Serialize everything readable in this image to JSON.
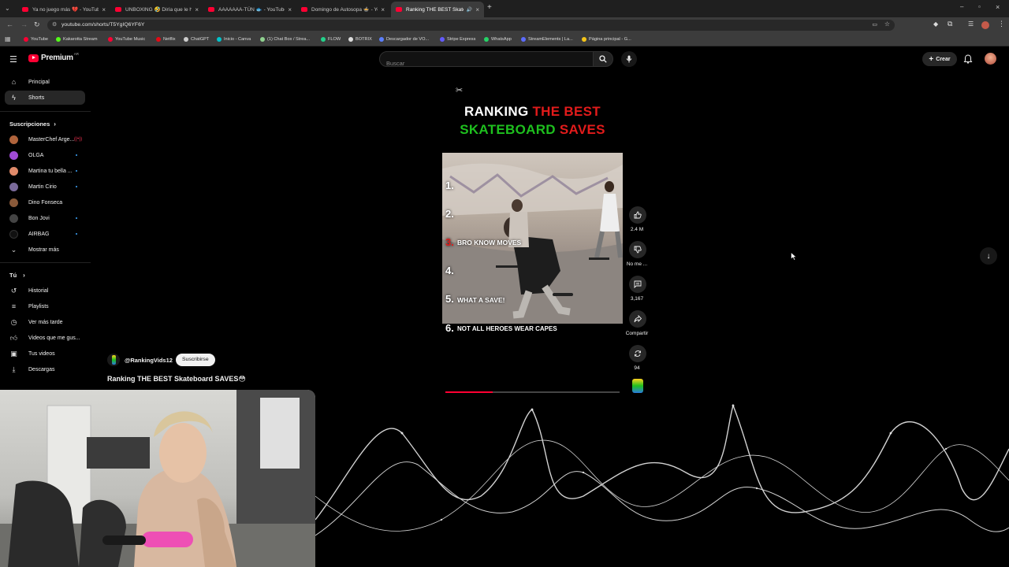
{
  "tabs": [
    {
      "label": "Ya no juego más 💔 - YouTube"
    },
    {
      "label": "UNBOXING 🤣 Diría que le hu..."
    },
    {
      "label": "AAAAAAA-TÚN 🐟 - YouTube"
    },
    {
      "label": "Domingo de Autosopa 🍲 - YouTube"
    },
    {
      "label": "Ranking THE BEST Skatebo..."
    }
  ],
  "url": "youtube.com/shorts/T5YgIQ6YF6Y",
  "bookmarks": [
    {
      "label": "YouTube",
      "color": "#ff0033"
    },
    {
      "label": "Kakarotta Stream",
      "color": "#53fc18"
    },
    {
      "label": "YouTube Music",
      "color": "#ff0033"
    },
    {
      "label": "Netflix",
      "color": "#e50914"
    },
    {
      "label": "ChatGPT",
      "color": "#cccccc"
    },
    {
      "label": "Inicio - Canva",
      "color": "#00c4cc"
    },
    {
      "label": "(1) Chat Box / Strea...",
      "color": "#8fd18f"
    },
    {
      "label": "FLOW",
      "color": "#23d18b"
    },
    {
      "label": "BOTRIX",
      "color": "#dddddd"
    },
    {
      "label": "Descargador de VO...",
      "color": "#5b7fff"
    },
    {
      "label": "Stripe Express",
      "color": "#635bff"
    },
    {
      "label": "WhatsApp",
      "color": "#25d366"
    },
    {
      "label": "StreamElements | La...",
      "color": "#5c6cff"
    },
    {
      "label": "Página principal - G...",
      "color": "#f5c518"
    }
  ],
  "yt": {
    "logo": "Premium",
    "logo_sup": "AR",
    "search_placeholder": "Buscar",
    "create": "Crear"
  },
  "sidebar": {
    "home": "Principal",
    "shorts": "Shorts",
    "subs_title": "Suscripciones",
    "subs": [
      {
        "name": "MasterChef Arge...",
        "color": "#b0643c",
        "live": true
      },
      {
        "name": "OLGA",
        "color": "#a04bd6",
        "live": false
      },
      {
        "name": "Martina tu bella ...",
        "color": "#e08a6a",
        "live": false
      },
      {
        "name": "Martin Cirio",
        "color": "#7a6a9a",
        "live": false
      },
      {
        "name": "Dino Fonseca",
        "color": "#8a5a3a",
        "live": false
      },
      {
        "name": "Bon Jovi",
        "color": "#444444",
        "live": false
      },
      {
        "name": "AIRBAG",
        "color": "#111111",
        "live": false
      }
    ],
    "show_more": "Mostrar más",
    "you_title": "Tú",
    "you_items": [
      {
        "label": "Historial",
        "icon": "history-icon"
      },
      {
        "label": "Playlists",
        "icon": "playlist-icon"
      },
      {
        "label": "Ver más tarde",
        "icon": "clock-icon"
      },
      {
        "label": "Videos que me gus...",
        "icon": "like-icon"
      },
      {
        "label": "Tus videos",
        "icon": "video-icon"
      },
      {
        "label": "Descargas",
        "icon": "download-icon"
      }
    ]
  },
  "short": {
    "title_line1_a": "RANKING ",
    "title_line1_b": "THE BEST",
    "title_line2_a": "SKATEBOARD ",
    "title_line2_b": "SAVES",
    "rank_labels": [
      "1.",
      "2.",
      "3.",
      "4.",
      "5.",
      "6."
    ],
    "rank_captions": [
      "",
      "",
      "BRO KNOW MOVES",
      "",
      "WHAT A SAVE!",
      "NOT ALL HEROES WEAR CAPES"
    ],
    "channel": "@RankingVids12",
    "subscribe": "Suscribirse",
    "video_title": "Ranking THE BEST Skateboard SAVES😳",
    "progress": 0.27
  },
  "actions": {
    "likes": "2.4 M",
    "dislike": "No me ...",
    "comments": "3,167",
    "share": "Compartir",
    "remix": "94"
  },
  "colors": {
    "red": "#e21b1b",
    "green": "#1ec01e",
    "accent": "#ff0033"
  }
}
